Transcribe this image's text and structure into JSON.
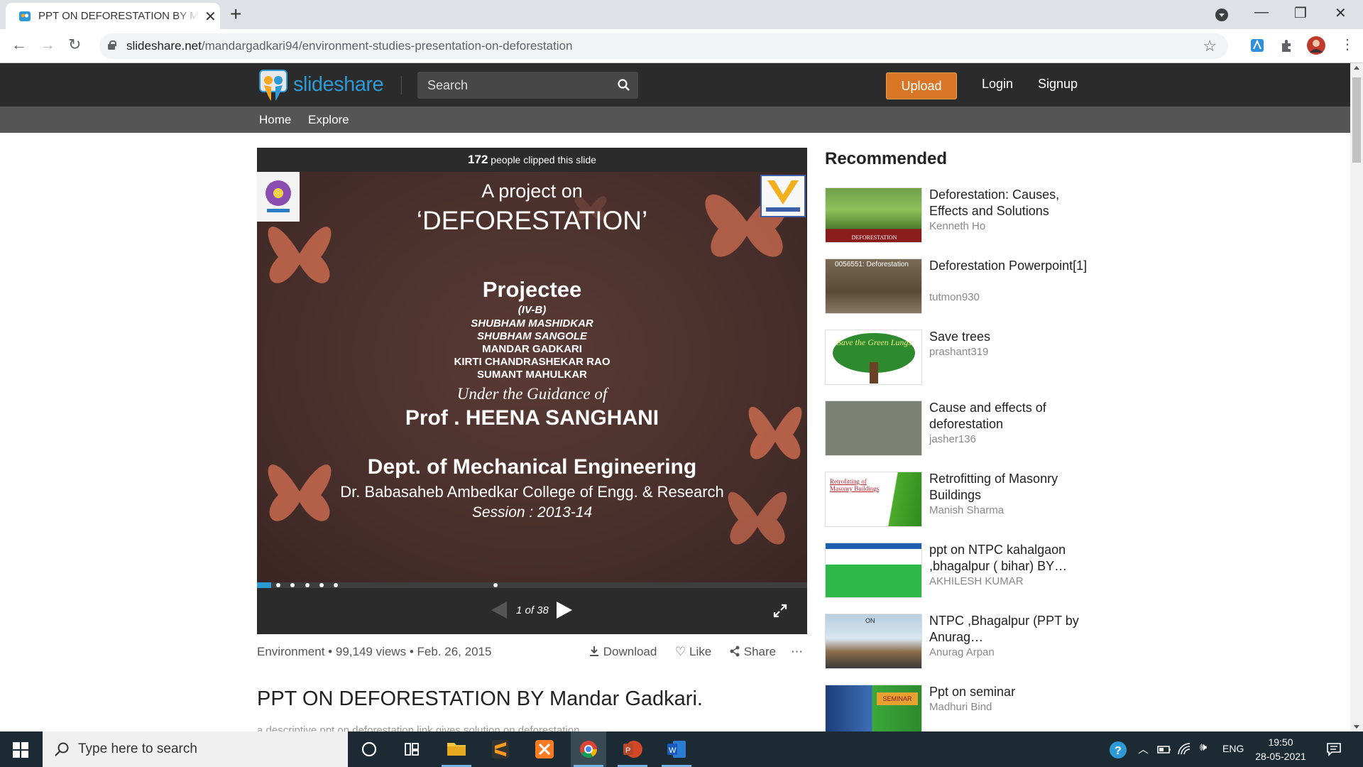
{
  "browser": {
    "tab_title": "PPT ON DEFORESTATION BY Mandar Gadkari.",
    "url_domain": "slideshare.net",
    "url_path": "/mandargadkari94/environment-studies-presentation-on-deforestation"
  },
  "site": {
    "logo_text": "slideshare",
    "search_placeholder": "Search",
    "upload_label": "Upload",
    "login_label": "Login",
    "signup_label": "Signup",
    "nav": [
      "Home",
      "Explore"
    ]
  },
  "player": {
    "clip_count": "172",
    "clip_text": "people clipped this slide",
    "page_counter": "1 of 38",
    "progress_fraction": 0.026
  },
  "slide": {
    "line1": "A project on",
    "line2": "‘DEFORESTATION’",
    "projectee_heading": "Projectee",
    "class": "(IV-B)",
    "members": [
      "SHUBHAM MASHIDKAR",
      "SHUBHAM SANGOLE",
      "MANDAR GADKARI",
      "KIRTI CHANDRASHEKAR RAO",
      "SUMANT MAHULKAR"
    ],
    "guidance": "Under the  Guidance of",
    "guide": "Prof . HEENA SANGHANI",
    "dept": "Dept. of Mechanical Engineering",
    "college": "Dr. Babasaheb Ambedkar College of Engg. & Research",
    "session": "Session : 2013-14"
  },
  "meta": {
    "category": "Environment",
    "views": "99,149 views",
    "date": "Feb. 26, 2015",
    "separator": "•",
    "download_label": "Download",
    "like_label": "Like",
    "share_label": "Share",
    "more_label": "⋯"
  },
  "doc": {
    "title": "PPT ON DEFORESTATION BY Mandar Gadkari.",
    "description": "a descriptive ppt on deforestation.link gives solution on deforestation."
  },
  "recommended": {
    "heading": "Recommended",
    "items": [
      {
        "title": "Deforestation: Causes, Effects and Solutions",
        "author": "Kenneth Ho",
        "thumb_label": "DEFORESTATION"
      },
      {
        "title": "Deforestation Powerpoint[1]",
        "author": "tutmon930",
        "thumb_label": "0056551: Deforestation"
      },
      {
        "title": "Save trees",
        "author": "prashant319",
        "thumb_label": "Save the Green Lungs"
      },
      {
        "title": "Cause and effects of deforestation",
        "author": "jasher136",
        "thumb_label": ""
      },
      {
        "title": "Retrofitting of Masonry Buildings",
        "author": "Manish Sharma",
        "thumb_label": "Retrofitting of Masonry Buildings"
      },
      {
        "title": "ppt on NTPC kahalgaon ,bhagalpur ( bihar) BY…",
        "author": "AKHILESH KUMAR",
        "thumb_label": ""
      },
      {
        "title": "NTPC ,Bhagalpur (PPT by Anurag…",
        "author": "Anurag Arpan",
        "thumb_label": "ON"
      },
      {
        "title": "Ppt on seminar",
        "author": "Madhuri Bind",
        "thumb_label": "SEMINAR"
      }
    ]
  },
  "taskbar": {
    "search_placeholder": "Type here to search",
    "lang": "ENG",
    "time": "19:50",
    "date": "28-05-2021"
  },
  "colors": {
    "brand_blue": "#2d9ad6",
    "upload_orange": "#d97625",
    "header_dark": "#2b2b2b",
    "subnav_gray": "#555555"
  }
}
